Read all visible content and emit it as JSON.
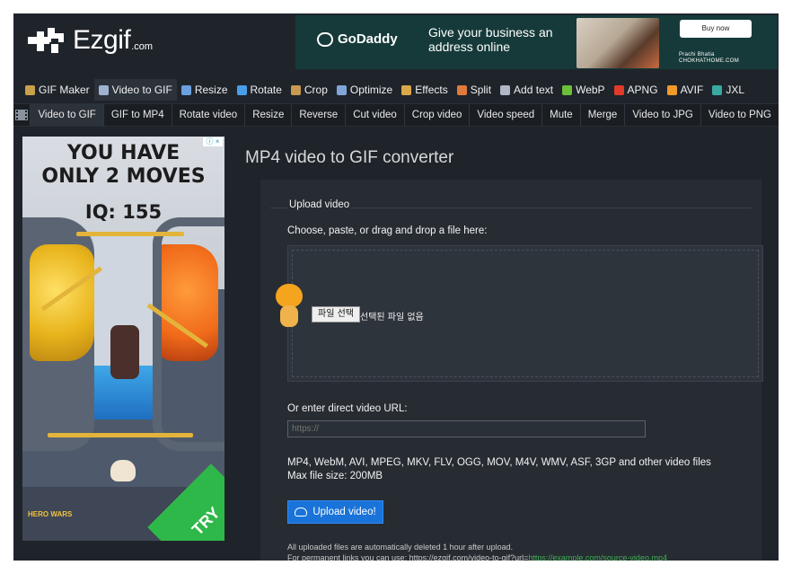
{
  "header": {
    "logo_text": "Ezgif",
    "logo_suffix": ".com",
    "ad": {
      "brand": "GoDaddy",
      "headline": "Give your business an address online",
      "cta": "Buy now",
      "person_name": "Prachi Bhatia",
      "person_site": "CHOKHATHOME.COM",
      "close_label": "▷×"
    }
  },
  "main_nav": [
    {
      "label": "GIF Maker",
      "icon": "gif-maker-icon",
      "color": "#c9a04a",
      "active": false
    },
    {
      "label": "Video to GIF",
      "icon": "video-icon",
      "color": "#9fb3d0",
      "active": true
    },
    {
      "label": "Resize",
      "icon": "resize-icon",
      "color": "#6aa0e0",
      "active": false
    },
    {
      "label": "Rotate",
      "icon": "rotate-icon",
      "color": "#4a9ee8",
      "active": false
    },
    {
      "label": "Crop",
      "icon": "crop-icon",
      "color": "#c89a50",
      "active": false
    },
    {
      "label": "Optimize",
      "icon": "optimize-icon",
      "color": "#7fa6d6",
      "active": false
    },
    {
      "label": "Effects",
      "icon": "effects-icon",
      "color": "#d9a84a",
      "active": false
    },
    {
      "label": "Split",
      "icon": "split-icon",
      "color": "#e07a3a",
      "active": false
    },
    {
      "label": "Add text",
      "icon": "add-text-icon",
      "color": "#b0b8c8",
      "active": false
    },
    {
      "label": "WebP",
      "icon": "webp-icon",
      "color": "#6cbf3a",
      "active": false
    },
    {
      "label": "APNG",
      "icon": "apng-icon",
      "color": "#e23a2a",
      "active": false
    },
    {
      "label": "AVIF",
      "icon": "avif-icon",
      "color": "#f29a2a",
      "active": false
    },
    {
      "label": "JXL",
      "icon": "jxl-icon",
      "color": "#3aa9a0",
      "active": false
    }
  ],
  "sub_nav": [
    {
      "label": "Video to GIF",
      "active": true
    },
    {
      "label": "GIF to MP4",
      "active": false
    },
    {
      "label": "Rotate video",
      "active": false
    },
    {
      "label": "Resize",
      "active": false
    },
    {
      "label": "Reverse",
      "active": false
    },
    {
      "label": "Cut video",
      "active": false
    },
    {
      "label": "Crop video",
      "active": false
    },
    {
      "label": "Video speed",
      "active": false
    },
    {
      "label": "Mute",
      "active": false
    },
    {
      "label": "Merge",
      "active": false
    },
    {
      "label": "Video to JPG",
      "active": false
    },
    {
      "label": "Video to PNG",
      "active": false
    }
  ],
  "side_ad": {
    "headline_1": "YOU HAVE",
    "headline_2": "ONLY 2 MOVES",
    "iq": "IQ: 155",
    "cta": "TRY",
    "brand": "HERO WARS",
    "badge": "ⓘ ×"
  },
  "page_title": "MP4 video to GIF converter",
  "upload": {
    "legend": "Upload video",
    "choose_label": "Choose, paste, or drag and drop a file here:",
    "file_button": "파일 선택",
    "file_status": "선택된 파일 없음",
    "url_label": "Or enter direct video URL:",
    "url_placeholder": "https://",
    "formats_line": "MP4, WebM, AVI, MPEG, MKV, FLV, OGG, MOV, M4V, WMV, ASF, 3GP and other video files",
    "max_size": "Max file size: 200MB",
    "button_label": "Upload video!",
    "note_1": "All uploaded files are automatically deleted 1 hour after upload.",
    "note_2_prefix": "For permanent links you can use: https://ezgif.com/video-to-gif?url=",
    "note_2_link": "https://example.com/source-video.mp4"
  }
}
